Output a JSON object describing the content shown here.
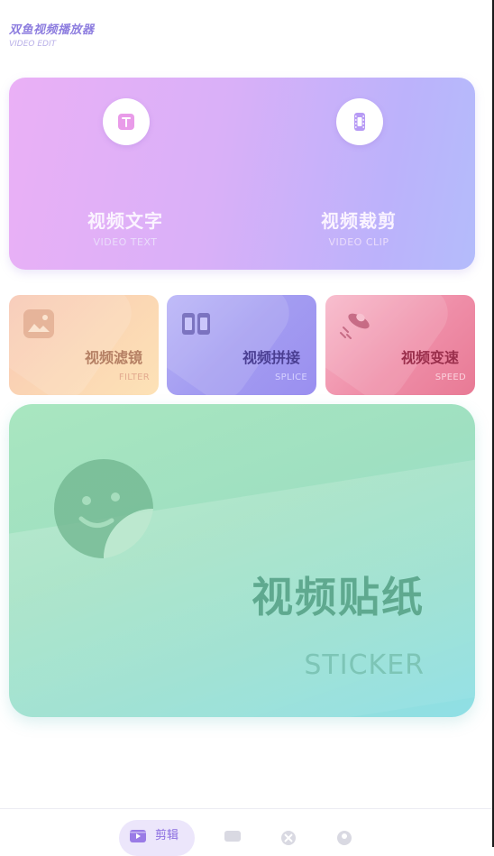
{
  "header": {
    "title": "双鱼视频播放器",
    "subtitle": "VIDEO EDIT"
  },
  "top_card": {
    "left": {
      "title": "视频文字",
      "subtitle": "VIDEO TEXT",
      "icon": "text-t-icon"
    },
    "right": {
      "title": "视频裁剪",
      "subtitle": "VIDEO CLIP",
      "icon": "film-clip-icon"
    }
  },
  "tiles": [
    {
      "title": "视频滤镜",
      "subtitle": "FILTER",
      "icon": "image-filter-icon"
    },
    {
      "title": "视频拼接",
      "subtitle": "SPLICE",
      "icon": "splice-frames-icon"
    },
    {
      "title": "视频变速",
      "subtitle": "SPEED",
      "icon": "ufo-speed-icon"
    }
  ],
  "sticker": {
    "title": "视频贴纸",
    "subtitle": "STICKER",
    "icon": "smiley-sticker-icon"
  },
  "bottom_nav": {
    "items": [
      {
        "label": "剪辑",
        "icon": "clip-tab-icon",
        "active": true
      },
      {
        "label": "",
        "icon": "message-tab-icon",
        "active": false
      },
      {
        "label": "",
        "icon": "game-tab-icon",
        "active": false
      },
      {
        "label": "",
        "icon": "profile-tab-icon",
        "active": false
      }
    ]
  },
  "colors": {
    "accent": "#8a6de0",
    "top_card_start": "#eab0f6",
    "top_card_end": "#b4bcfb",
    "filter_tile": "#fbd7b4",
    "splice_tile": "#a39cf1",
    "speed_tile": "#ef8ea8",
    "sticker_card": "#9fe0c1"
  }
}
